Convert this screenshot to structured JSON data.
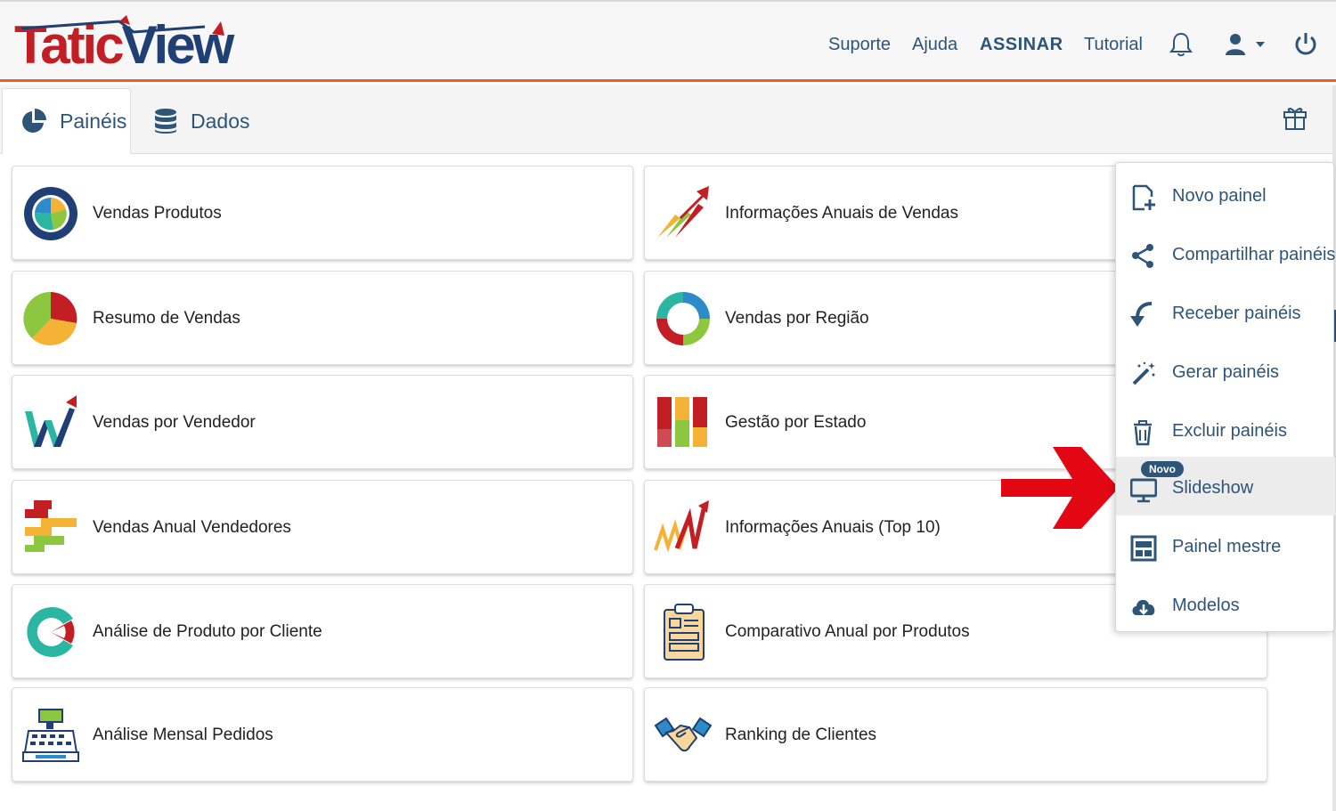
{
  "app": {
    "logo_part1": "Tatic",
    "logo_part2": "View",
    "colors": {
      "brand_red": "#c41e25",
      "brand_blue": "#1f3f75",
      "accent_orange": "#e8612c",
      "link": "#2e5578"
    }
  },
  "header": {
    "links": [
      "Suporte",
      "Ajuda",
      "ASSINAR",
      "Tutorial"
    ],
    "icons": [
      "bell-icon",
      "user-icon",
      "power-icon"
    ]
  },
  "tabs": [
    {
      "label": "Painéis",
      "icon": "pie-chart-icon",
      "active": true
    },
    {
      "label": "Dados",
      "icon": "database-icon",
      "active": false
    }
  ],
  "panels": [
    {
      "label": "Vendas Produtos",
      "icon": "pie-ring-icon"
    },
    {
      "label": "Informações Anuais de Vendas",
      "icon": "rising-arrows-icon"
    },
    {
      "label": "Resumo de Vendas",
      "icon": "pie-icon"
    },
    {
      "label": "Vendas por Região",
      "icon": "donut-icon"
    },
    {
      "label": "Vendas por Vendedor",
      "icon": "w-arrow-icon"
    },
    {
      "label": "Gestão por Estado",
      "icon": "stacked-bars-icon"
    },
    {
      "label": "Vendas Anual Vendedores",
      "icon": "gantt-icon"
    },
    {
      "label": "Informações Anuais (Top 10)",
      "icon": "zigzag-arrow-icon"
    },
    {
      "label": "Análise de Produto por Cliente",
      "icon": "c-pie-icon"
    },
    {
      "label": "Comparativo Anual por Produtos",
      "icon": "clipboard-icon"
    },
    {
      "label": "Análise Mensal Pedidos",
      "icon": "cash-register-icon"
    },
    {
      "label": "Ranking de Clientes",
      "icon": "handshake-icon"
    }
  ],
  "menu": {
    "items": [
      {
        "label": "Novo painel",
        "icon": "new-document-icon"
      },
      {
        "label": "Compartilhar painéis",
        "icon": "share-icon"
      },
      {
        "label": "Receber painéis",
        "icon": "receive-arrow-icon"
      },
      {
        "label": "Gerar painéis",
        "icon": "magic-wand-icon"
      },
      {
        "label": "Excluir painéis",
        "icon": "trash-icon"
      },
      {
        "label": "Slideshow",
        "icon": "monitor-icon",
        "badge": "Novo",
        "highlighted": true
      },
      {
        "label": "Painel mestre",
        "icon": "master-panel-icon"
      },
      {
        "label": "Modelos",
        "icon": "cloud-download-icon"
      }
    ]
  }
}
